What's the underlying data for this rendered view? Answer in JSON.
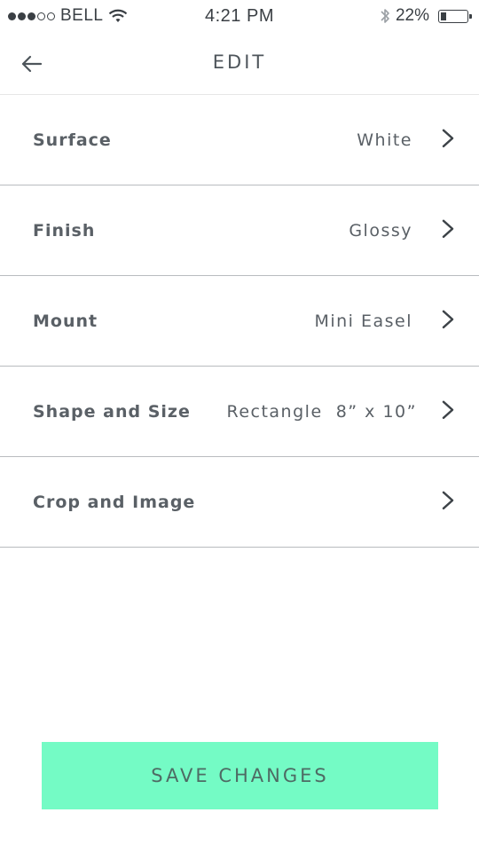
{
  "status_bar": {
    "carrier": "BELL",
    "time": "4:21 PM",
    "battery_percent": "22%",
    "battery_level": 0.22,
    "signal_filled": 3,
    "signal_total": 5,
    "icons": [
      "wifi-icon",
      "bluetooth-icon",
      "battery-icon"
    ]
  },
  "header": {
    "title": "EDIT",
    "back_icon": "arrow-left-icon"
  },
  "settings": [
    {
      "label": "Surface",
      "value": "White"
    },
    {
      "label": "Finish",
      "value": "Glossy"
    },
    {
      "label": "Mount",
      "value": "Mini Easel"
    },
    {
      "label": "Shape and Size",
      "value": "Rectangle  8” x 10”"
    },
    {
      "label": "Crop and Image",
      "value": ""
    }
  ],
  "footer": {
    "save_label": "SAVE CHANGES"
  },
  "colors": {
    "accent": "#74fbc5",
    "text": "#5a6066",
    "divider": "#b9bcbf"
  }
}
